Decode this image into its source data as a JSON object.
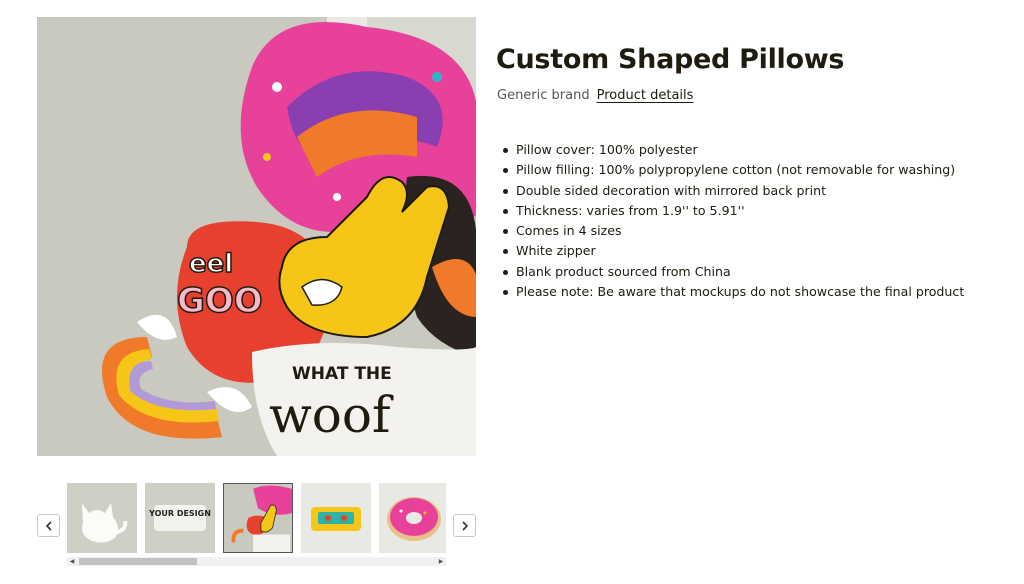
{
  "product": {
    "title": "Custom Shaped Pillows",
    "brand": "Generic brand",
    "details_link": "Product details",
    "features": [
      "Pillow cover: 100% polyester",
      "Pillow filling: 100% polypropylene cotton (not removable for washing)",
      "Double sided decoration with mirrored back print",
      "Thickness: varies from 1.9'' to 5.91''",
      "Comes in 4 sizes",
      "White zipper",
      "Blank product sourced from China",
      "Please note: Be aware that mockups do not showcase the final product"
    ]
  },
  "hero_image": {
    "pillow_texts": [
      "eel",
      "GOO",
      "WHAT THE",
      "woof"
    ]
  },
  "gallery": {
    "prev_icon": "chevron-left-icon",
    "next_icon": "chevron-right-icon",
    "active_index": 2,
    "thumbnails": [
      {
        "name": "cat-pillow",
        "text": ""
      },
      {
        "name": "your-design-pillow",
        "text": "YOUR DESIGN"
      },
      {
        "name": "shaped-pillows-collage",
        "text": ""
      },
      {
        "name": "cassette-pillow",
        "text": ""
      },
      {
        "name": "donut-pillow",
        "text": ""
      }
    ]
  },
  "colors": {
    "title": "#1e1b10",
    "hero_bg": "#c9c9bf",
    "pink": "#e8419a",
    "yellow": "#f5c518",
    "orange": "#f07a2a"
  }
}
